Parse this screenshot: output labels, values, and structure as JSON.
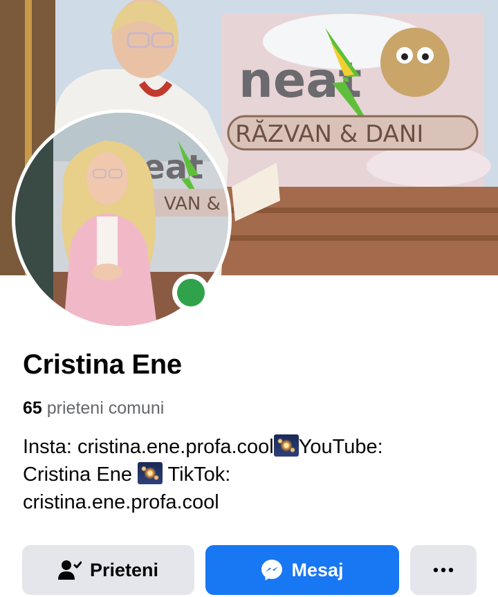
{
  "profile": {
    "name": "Cristina Ene",
    "mutual_count": "65",
    "mutual_label": "prieteni comuni",
    "online_status_color": "#31a24c"
  },
  "bio": {
    "line1_a": "Insta: cristina.ene.profa.cool",
    "line1_b": "YouTube:",
    "line2_a": "Cristina Ene ",
    "line2_b": " TikTok:",
    "line3": "cristina.ene.profa.cool",
    "emoji_icon": "fireworks-icon"
  },
  "actions": {
    "friends_label": "Prieteni",
    "friends_icon": "friends-check-icon",
    "message_label": "Mesaj",
    "message_icon": "messenger-icon",
    "more_icon": "more-dots-icon"
  },
  "colors": {
    "accent": "#1877f2",
    "secondary_button": "#e4e6eb",
    "muted_text": "#65676b"
  }
}
